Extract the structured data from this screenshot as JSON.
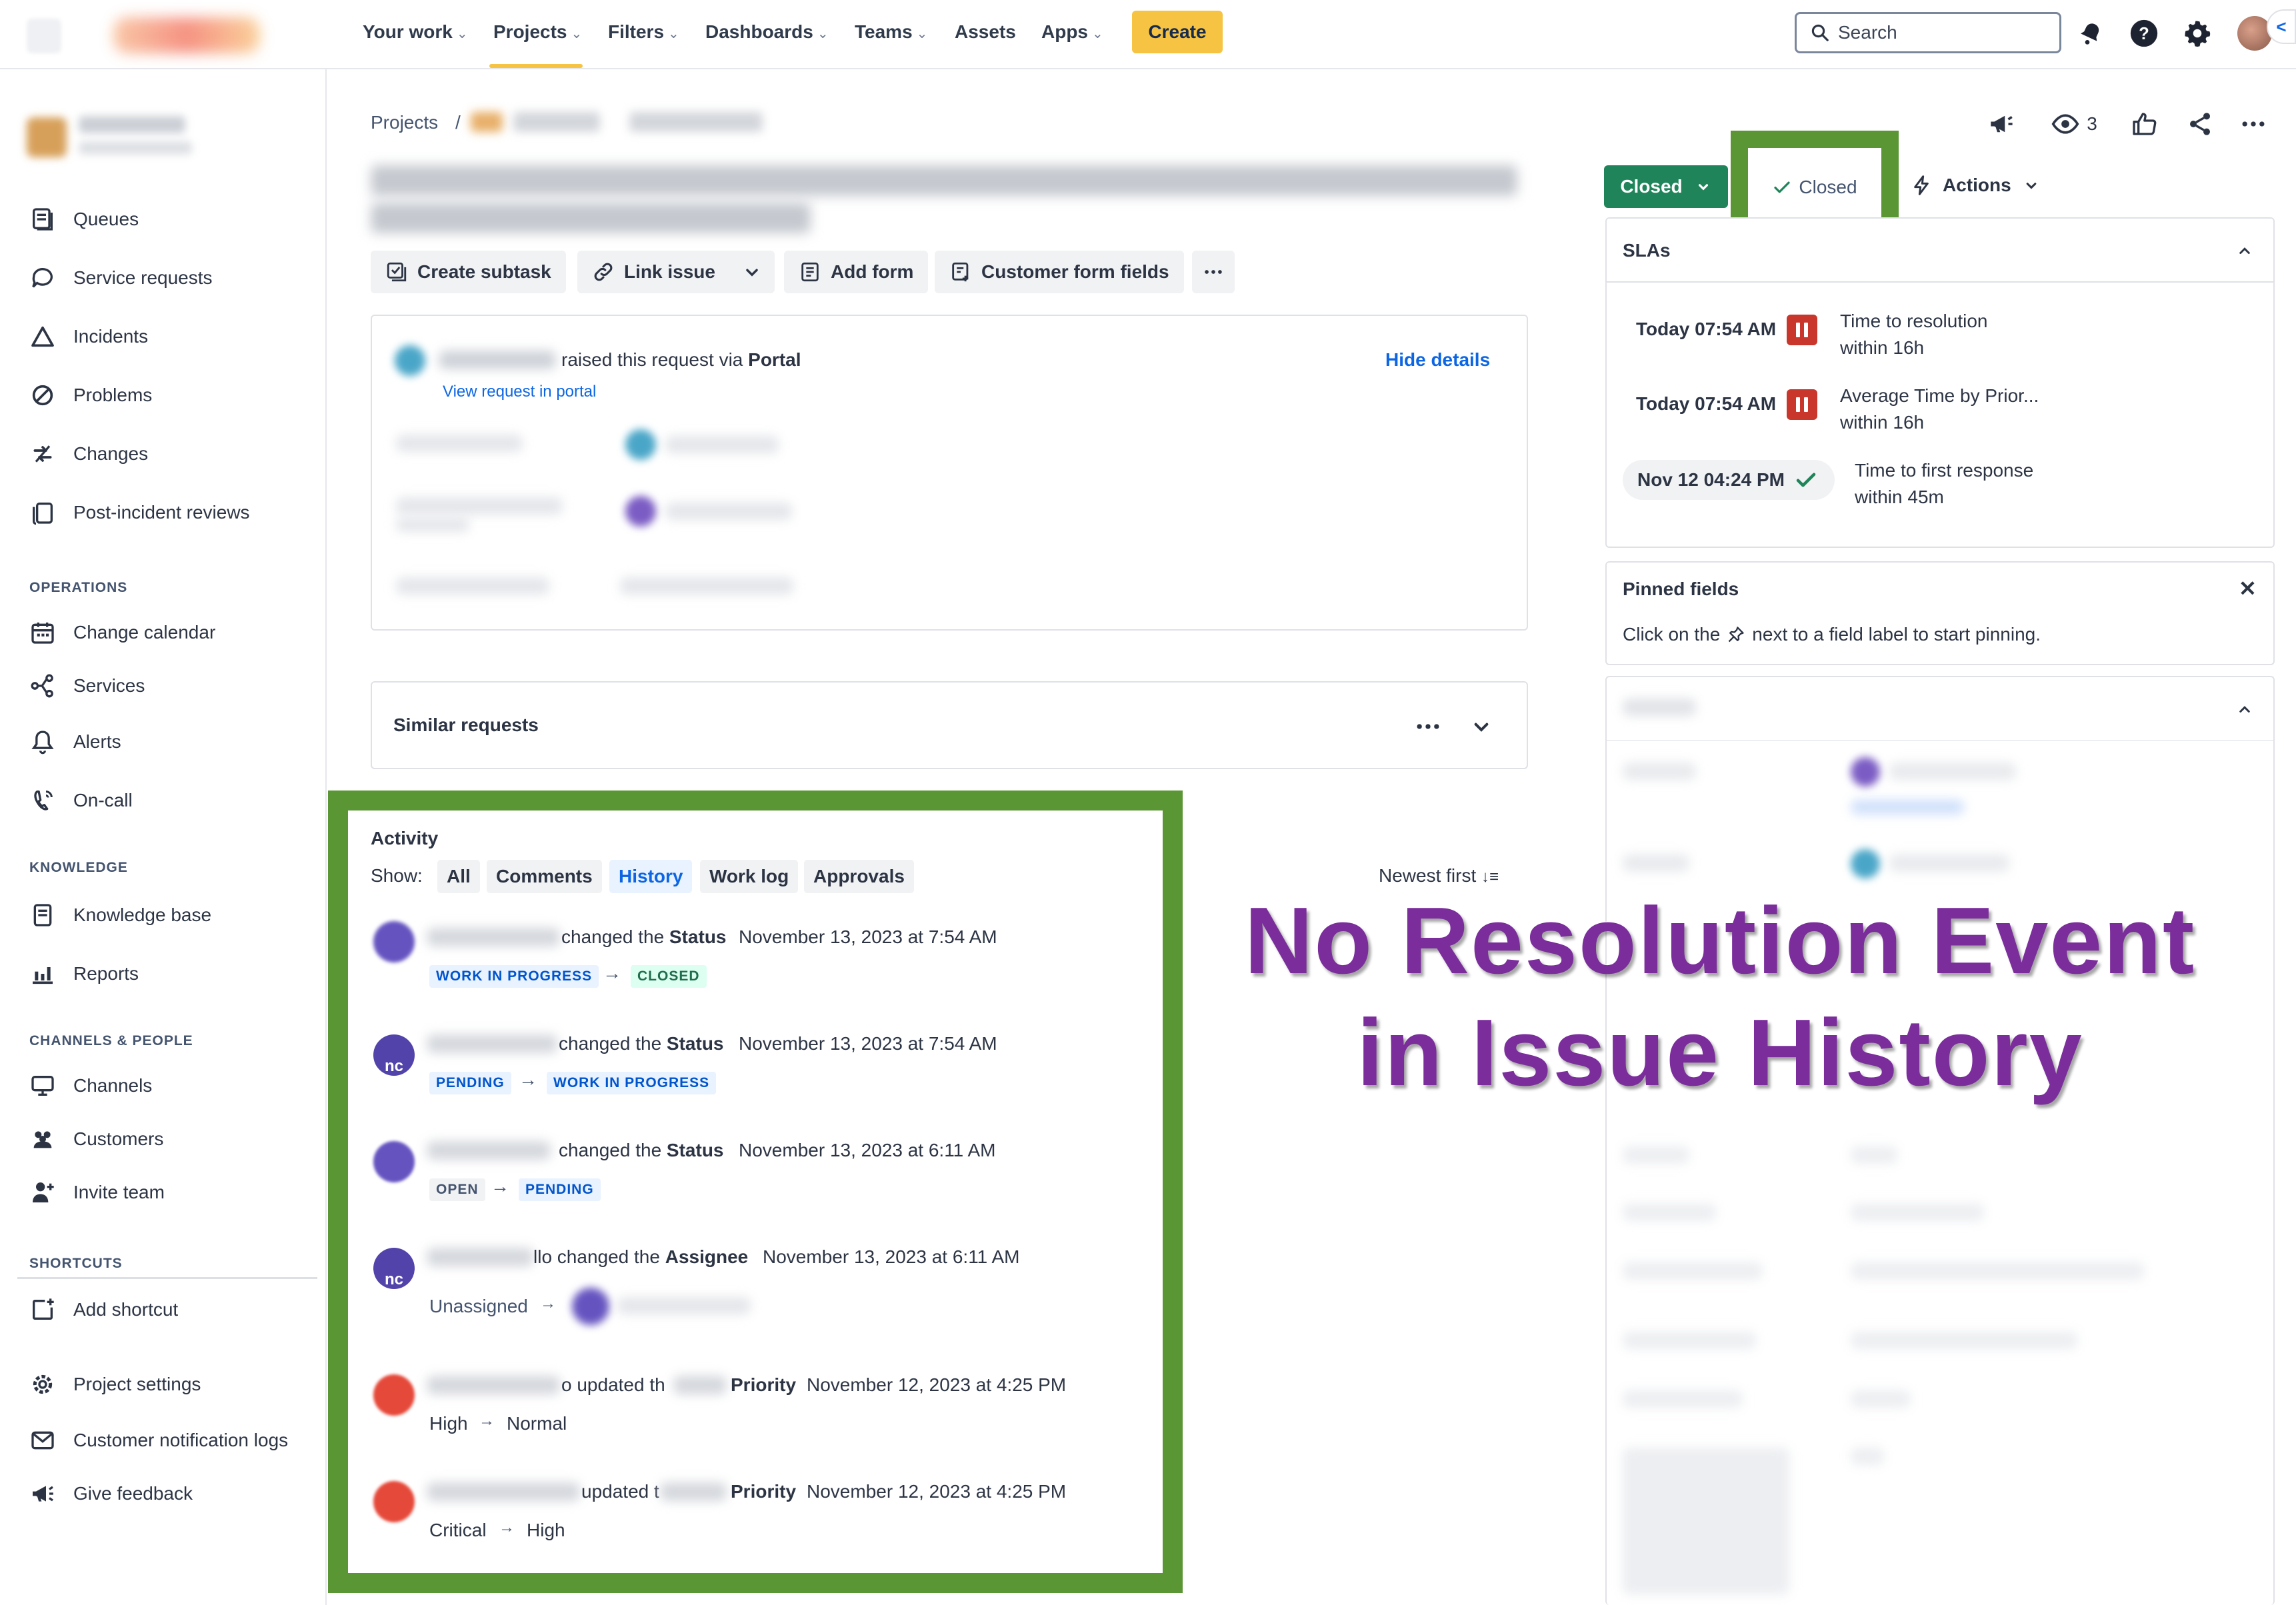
{
  "topnav": {
    "items": [
      {
        "label": "Your work",
        "has_menu": true
      },
      {
        "label": "Projects",
        "has_menu": true
      },
      {
        "label": "Filters",
        "has_menu": true
      },
      {
        "label": "Dashboards",
        "has_menu": true
      },
      {
        "label": "Teams",
        "has_menu": true
      },
      {
        "label": "Assets",
        "has_menu": false
      },
      {
        "label": "Apps",
        "has_menu": true
      }
    ],
    "create_label": "Create",
    "search_placeholder": "Search",
    "collapse_glyph": "<",
    "icons": [
      "notifications-icon",
      "help-icon",
      "settings-icon"
    ],
    "accent_color": "#f6c342"
  },
  "sidebar": {
    "items": [
      {
        "label": "Queues",
        "icon": "queues-icon"
      },
      {
        "label": "Service requests",
        "icon": "service-requests-icon"
      },
      {
        "label": "Incidents",
        "icon": "incidents-icon"
      },
      {
        "label": "Problems",
        "icon": "problems-icon"
      },
      {
        "label": "Changes",
        "icon": "changes-icon"
      },
      {
        "label": "Post-incident reviews",
        "icon": "post-incident-reviews-icon"
      }
    ],
    "operations_heading": "OPERATIONS",
    "operations": [
      {
        "label": "Change calendar",
        "icon": "calendar-icon"
      },
      {
        "label": "Services",
        "icon": "services-icon"
      },
      {
        "label": "Alerts",
        "icon": "alerts-icon"
      },
      {
        "label": "On-call",
        "icon": "on-call-icon"
      }
    ],
    "knowledge_heading": "KNOWLEDGE",
    "knowledge": [
      {
        "label": "Knowledge base",
        "icon": "knowledge-base-icon"
      },
      {
        "label": "Reports",
        "icon": "reports-icon"
      }
    ],
    "channels_heading": "CHANNELS & PEOPLE",
    "channels": [
      {
        "label": "Channels",
        "icon": "channels-icon"
      },
      {
        "label": "Customers",
        "icon": "customers-icon"
      },
      {
        "label": "Invite team",
        "icon": "invite-team-icon"
      }
    ],
    "shortcuts_heading": "SHORTCUTS",
    "shortcuts": [
      {
        "label": "Add shortcut",
        "icon": "add-shortcut-icon"
      }
    ],
    "footer": [
      {
        "label": "Project settings",
        "icon": "project-settings-icon"
      },
      {
        "label": "Customer notification logs",
        "icon": "notification-logs-icon"
      },
      {
        "label": "Give feedback",
        "icon": "feedback-icon"
      }
    ]
  },
  "main": {
    "breadcrumb_root": "Projects",
    "breadcrumb_sep": "/",
    "actions": {
      "create_subtask": "Create subtask",
      "link_issue": "Link issue",
      "add_form": "Add form",
      "customer_form_fields": "Customer form fields"
    },
    "request": {
      "raised_text": "raised this request via",
      "channel": "Portal",
      "view_link": "View request in portal",
      "hide_details": "Hide details"
    },
    "similar_requests": "Similar requests"
  },
  "activity": {
    "title": "Activity",
    "show_label": "Show:",
    "filters": [
      {
        "label": "All",
        "active": false
      },
      {
        "label": "Comments",
        "active": false
      },
      {
        "label": "History",
        "active": true
      },
      {
        "label": "Work log",
        "active": false
      },
      {
        "label": "Approvals",
        "active": false
      }
    ],
    "sort_label": "Newest first",
    "events": [
      {
        "action": "changed the",
        "field": "Status",
        "timestamp": "November 13, 2023 at 7:54 AM",
        "from": "WORK IN PROGRESS",
        "to": "CLOSED",
        "avatar_color": "#6554c0",
        "initials": ""
      },
      {
        "action": "changed the",
        "field": "Status",
        "timestamp": "November 13, 2023 at 7:54 AM",
        "from": "PENDING",
        "to": "WORK IN PROGRESS",
        "avatar_color": "#5243aa",
        "initials": "nc"
      },
      {
        "action": "changed the",
        "field": "Status",
        "timestamp": "November 13, 2023 at 6:11 AM",
        "from": "OPEN",
        "to": "PENDING",
        "avatar_color": "#6554c0",
        "initials": ""
      },
      {
        "action": "llo changed the",
        "field": "Assignee",
        "timestamp": "November 13, 2023 at 6:11 AM",
        "from": "Unassigned",
        "to": "",
        "avatar_color": "#5243aa",
        "initials": "nc"
      },
      {
        "action": "o updated th",
        "field": "Priority",
        "timestamp": "November 12, 2023 at 4:25 PM",
        "from": "High",
        "to": "Normal",
        "avatar_color": "#e5493a",
        "initials": ""
      },
      {
        "action": "updated t",
        "field": "Priority",
        "timestamp": "November 12, 2023 at 4:25 PM",
        "from": "Critical",
        "to": "High",
        "avatar_color": "#e5493a",
        "initials": ""
      }
    ]
  },
  "annotation": {
    "line1": "No Resolution Event",
    "line2": "in Issue History",
    "color": "#7a2d9b",
    "frame_color": "#5b9634"
  },
  "right_panel": {
    "watchers_count": "3",
    "status_button": "Closed",
    "status_option": "Closed",
    "actions_label": "Actions",
    "slas_title": "SLAs",
    "slas": [
      {
        "time": "Today 07:54 AM",
        "state": "paused",
        "name": "Time to resolution",
        "goal": "within 16h"
      },
      {
        "time": "Today 07:54 AM",
        "state": "paused",
        "name": "Average Time by Prior...",
        "goal": "within 16h"
      },
      {
        "time": "Nov 12 04:24 PM",
        "state": "met",
        "name": "Time to first response",
        "goal": "within 45m"
      }
    ],
    "pinned_title": "Pinned fields",
    "pinned_text_before": "Click on the",
    "pinned_text_after": "next to a field label to start pinning."
  }
}
